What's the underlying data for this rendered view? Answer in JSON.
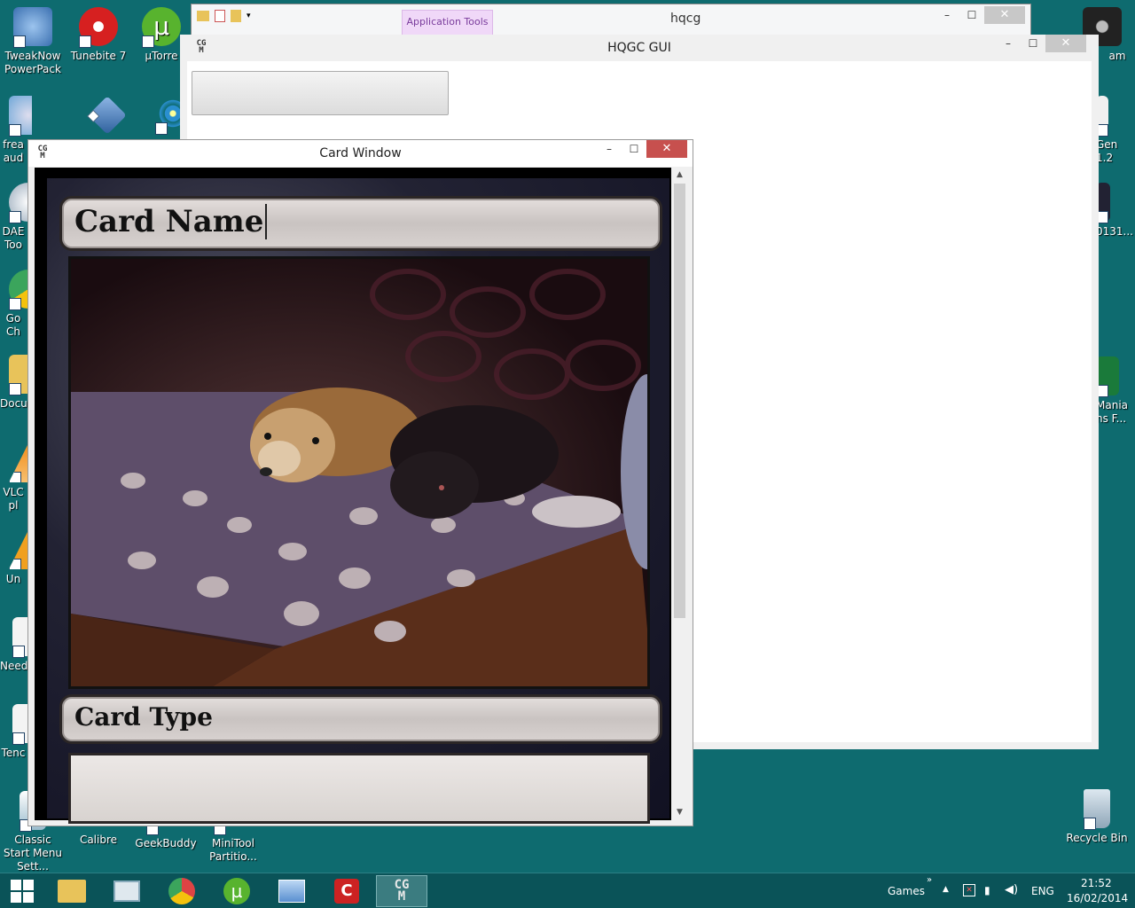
{
  "desktop": {
    "icons_left": [
      {
        "label": "TweakNow PowerPack",
        "icon": "tweaknow-icon",
        "color": "#3a6fb0"
      },
      {
        "label": "Tunebite 7",
        "icon": "tunebite-icon",
        "color": "#d62020"
      },
      {
        "label": "µTorre",
        "icon": "utorrent-icon",
        "color": "#58b32e"
      },
      {
        "label": "frea aud",
        "icon": "freaudio-icon",
        "color": "#6fa7d8"
      },
      {
        "label": "DAE Too",
        "icon": "daemon-tools-icon",
        "color": "#e0e8f0"
      },
      {
        "label": "Go Ch",
        "icon": "chrome-icon",
        "color": "#d44"
      },
      {
        "label": "Docu",
        "icon": "folder-icon",
        "color": "#e8c35a"
      },
      {
        "label": "VLC pl",
        "icon": "vlc-icon",
        "color": "#f08c1a"
      },
      {
        "label": "Un",
        "icon": "uninstall-icon",
        "color": "#f0a020"
      },
      {
        "label": "Need",
        "icon": "document-icon",
        "color": "#f4f4f4"
      },
      {
        "label": "Tenc",
        "icon": "document-icon",
        "color": "#f4f4f4"
      }
    ],
    "icons_right": [
      {
        "label": "am",
        "icon": "steam-icon",
        "color": "#222"
      },
      {
        "label": "Gen 1.2",
        "icon": "document-icon",
        "color": "#f0f0f0"
      },
      {
        "label": "0131...",
        "icon": "image-icon",
        "color": "#223"
      },
      {
        "label": "Mania ns F...",
        "icon": "mania-icon",
        "color": "#1a7a3a"
      }
    ],
    "icons_bottom": [
      {
        "label": "Classic Start Menu Sett...",
        "icon": "classic-start-icon",
        "color": "#eee"
      },
      {
        "label": "Calibre",
        "icon": "calibre-icon",
        "color": "#8b1a1a"
      },
      {
        "label": "GeekBuddy",
        "icon": "geekbuddy-icon",
        "color": "#444"
      },
      {
        "label": "MiniTool Partitio...",
        "icon": "minitool-icon",
        "color": "#333"
      }
    ],
    "recycle_bin": {
      "label": "Recycle Bin",
      "icon": "recycle-bin-icon"
    },
    "second_row_icons": [
      {
        "icon": "network-icon",
        "color": "#2d5f9c"
      },
      {
        "icon": "wifi-app-icon",
        "color": "#2a8fd0"
      }
    ]
  },
  "explorer_window": {
    "title": "hqcg",
    "ribbon_tab": "Application Tools"
  },
  "hqgc_window": {
    "title": "HQGC GUI",
    "button_label": "",
    "logo": "CG\nM"
  },
  "card_window": {
    "title": "Card Window",
    "card_name": "Card Name",
    "card_type": "Card Type",
    "image": "dogs-photo-icon"
  },
  "taskbar": {
    "apps": [
      {
        "name": "file-explorer",
        "icon": "folder-icon",
        "color": "#e8c35a"
      },
      {
        "name": "task-manager",
        "icon": "monitor-icon",
        "color": "#8ab"
      },
      {
        "name": "chrome",
        "icon": "chrome-icon",
        "color": "#d44"
      },
      {
        "name": "utorrent",
        "icon": "utorrent-icon",
        "color": "#58b32e"
      },
      {
        "name": "control-panel",
        "icon": "control-panel-icon",
        "color": "#5a8fd0"
      },
      {
        "name": "comodo",
        "icon": "comodo-icon",
        "color": "#c22"
      },
      {
        "name": "cgm-app",
        "icon": "cgm-icon",
        "color": "#ccc",
        "active": true
      }
    ],
    "toolbar_label": "Games",
    "language": "ENG",
    "time": "21:52",
    "date": "16/02/2014"
  }
}
